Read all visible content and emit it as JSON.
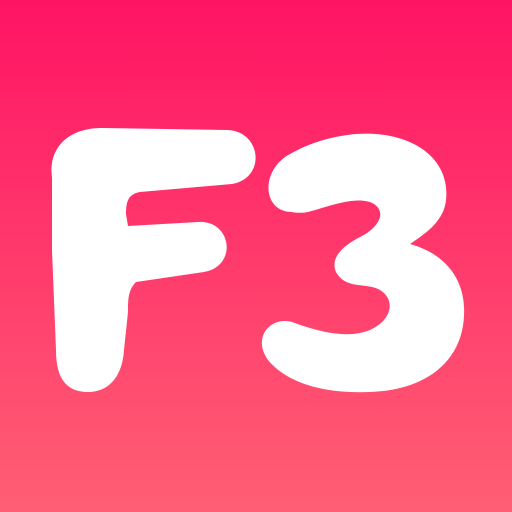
{
  "icon": {
    "logo_text": "F3",
    "colors": {
      "gradient_top": "#FF1464",
      "gradient_bottom": "#FF5F74",
      "glyph": "#FFFFFF"
    }
  }
}
